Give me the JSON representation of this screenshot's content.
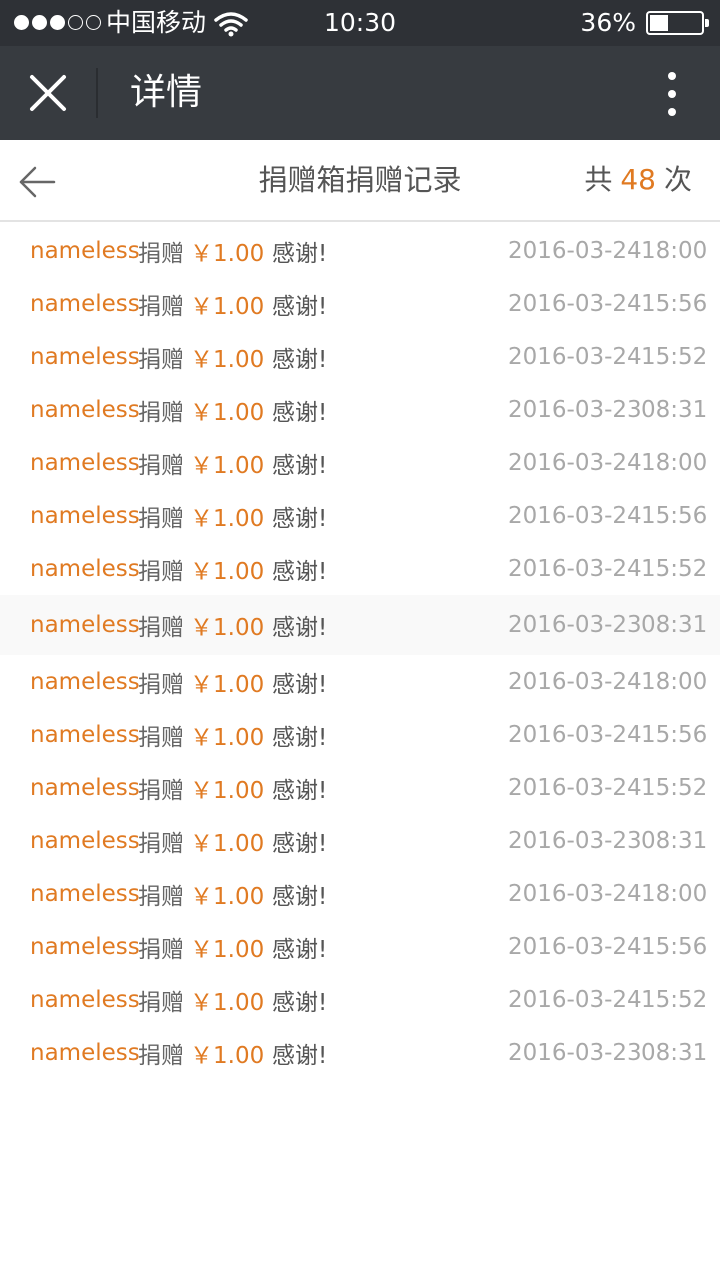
{
  "status_bar": {
    "carrier": "中国移动",
    "time": "10:30",
    "battery_percent": "36%",
    "battery_level": 0.36,
    "signal_bars": 3,
    "signal_total": 5,
    "icons": [
      "signal-icon",
      "wifi-icon",
      "battery-icon"
    ]
  },
  "nav": {
    "title": "详情",
    "close_icon": "close-icon",
    "more_icon": "more-vertical-icon"
  },
  "header": {
    "title": "捐赠箱捐赠记录",
    "count_prefix": "共",
    "count": "48",
    "count_suffix": "次",
    "back_icon": "back-arrow-icon"
  },
  "colors": {
    "accent": "#e07a22",
    "statusbar": "#2e3136",
    "navbar": "#373b40",
    "muted": "#a8a8a8"
  },
  "records": [
    {
      "name": "nameless",
      "verb": "捐赠",
      "amount": "￥1.00",
      "thanks": "感谢!",
      "date": "2016-03-24",
      "time": "18:00"
    },
    {
      "name": "nameless",
      "verb": "捐赠",
      "amount": "￥1.00",
      "thanks": "感谢!",
      "date": "2016-03-24",
      "time": "15:56"
    },
    {
      "name": "nameless",
      "verb": "捐赠",
      "amount": "￥1.00",
      "thanks": "感谢!",
      "date": "2016-03-24",
      "time": "15:52"
    },
    {
      "name": "nameless",
      "verb": "捐赠",
      "amount": "￥1.00",
      "thanks": "感谢!",
      "date": "2016-03-23",
      "time": "08:31"
    },
    {
      "name": "nameless",
      "verb": "捐赠",
      "amount": "￥1.00",
      "thanks": "感谢!",
      "date": "2016-03-24",
      "time": "18:00"
    },
    {
      "name": "nameless",
      "verb": "捐赠",
      "amount": "￥1.00",
      "thanks": "感谢!",
      "date": "2016-03-24",
      "time": "15:56"
    },
    {
      "name": "nameless",
      "verb": "捐赠",
      "amount": "￥1.00",
      "thanks": "感谢!",
      "date": "2016-03-24",
      "time": "15:52"
    },
    {
      "name": "nameless",
      "verb": "捐赠",
      "amount": "￥1.00",
      "thanks": "感谢!",
      "date": "2016-03-23",
      "time": "08:31",
      "highlighted": true
    },
    {
      "name": "nameless",
      "verb": "捐赠",
      "amount": "￥1.00",
      "thanks": "感谢!",
      "date": "2016-03-24",
      "time": "18:00"
    },
    {
      "name": "nameless",
      "verb": "捐赠",
      "amount": "￥1.00",
      "thanks": "感谢!",
      "date": "2016-03-24",
      "time": "15:56"
    },
    {
      "name": "nameless",
      "verb": "捐赠",
      "amount": "￥1.00",
      "thanks": "感谢!",
      "date": "2016-03-24",
      "time": "15:52"
    },
    {
      "name": "nameless",
      "verb": "捐赠",
      "amount": "￥1.00",
      "thanks": "感谢!",
      "date": "2016-03-23",
      "time": "08:31"
    },
    {
      "name": "nameless",
      "verb": "捐赠",
      "amount": "￥1.00",
      "thanks": "感谢!",
      "date": "2016-03-24",
      "time": "18:00"
    },
    {
      "name": "nameless",
      "verb": "捐赠",
      "amount": "￥1.00",
      "thanks": "感谢!",
      "date": "2016-03-24",
      "time": "15:56"
    },
    {
      "name": "nameless",
      "verb": "捐赠",
      "amount": "￥1.00",
      "thanks": "感谢!",
      "date": "2016-03-24",
      "time": "15:52"
    },
    {
      "name": "nameless",
      "verb": "捐赠",
      "amount": "￥1.00",
      "thanks": "感谢!",
      "date": "2016-03-23",
      "time": "08:31"
    }
  ]
}
